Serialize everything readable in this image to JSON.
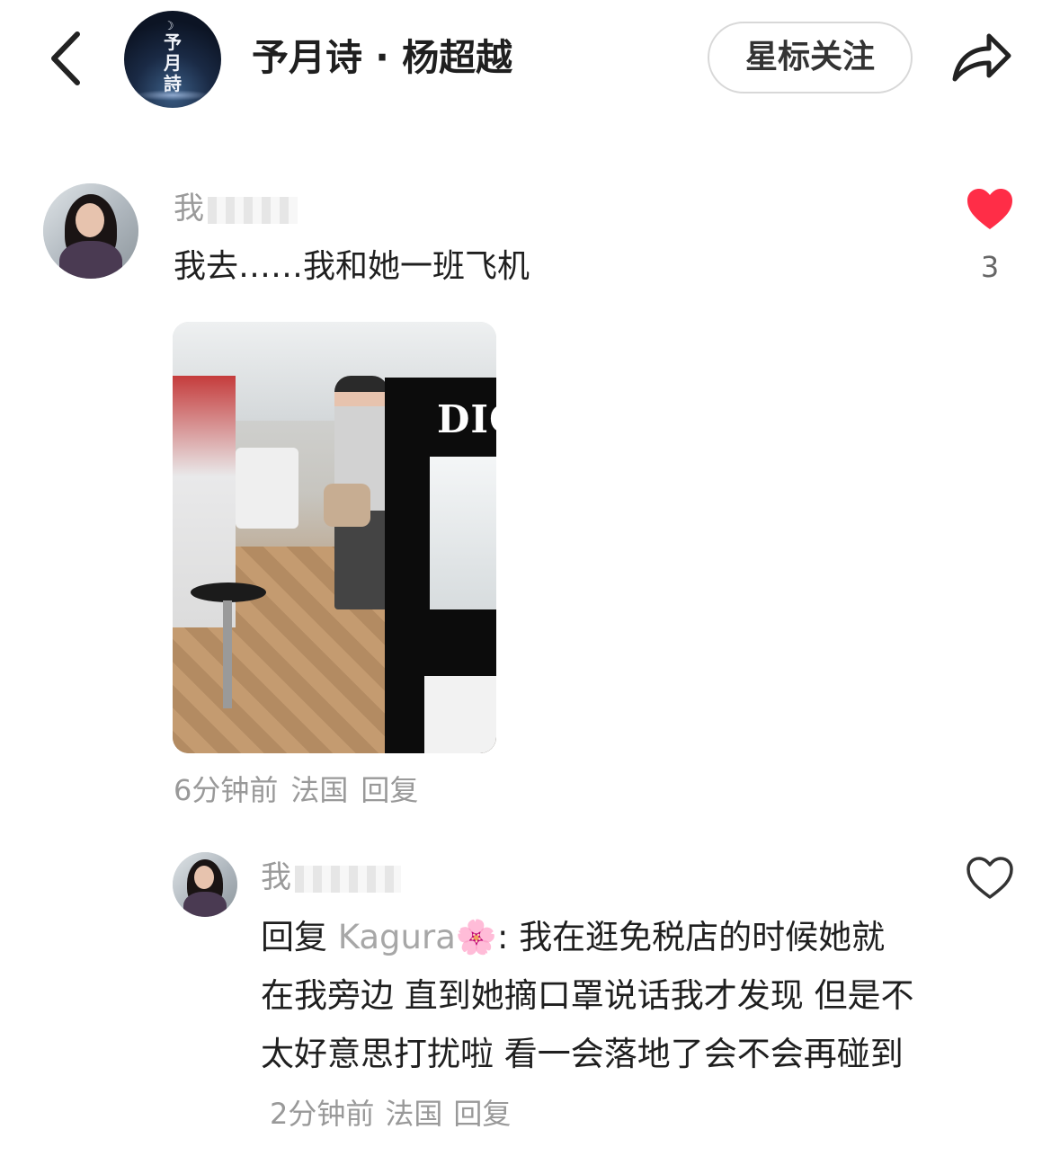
{
  "header": {
    "back_icon": "chevron-left-icon",
    "logo_text": "予月詩",
    "title": "予月诗 · 杨超越",
    "star_follow_label": "星标关注",
    "share_icon": "share-arrow-icon"
  },
  "comments": [
    {
      "username": "我",
      "text": "我去……我和她一班飞机",
      "like_icon": "heart-filled-icon",
      "like_color": "#ff2d47",
      "like_count": "3",
      "photo_text": "DIOR",
      "time": "6分钟前",
      "location": "法国",
      "reply_label": "回复"
    },
    {
      "username": "我",
      "reply_prefix": "回复",
      "mention": "Kagura🌸",
      "separator": ": ",
      "text": "我在逛免税店的时候她就在我旁边 直到她摘口罩说话我才发现 但是不太好意思打扰啦 看一会落地了会不会再碰到",
      "like_icon": "heart-outline-icon",
      "time": "2分钟前",
      "location": "法国",
      "reply_label": "回复"
    }
  ]
}
